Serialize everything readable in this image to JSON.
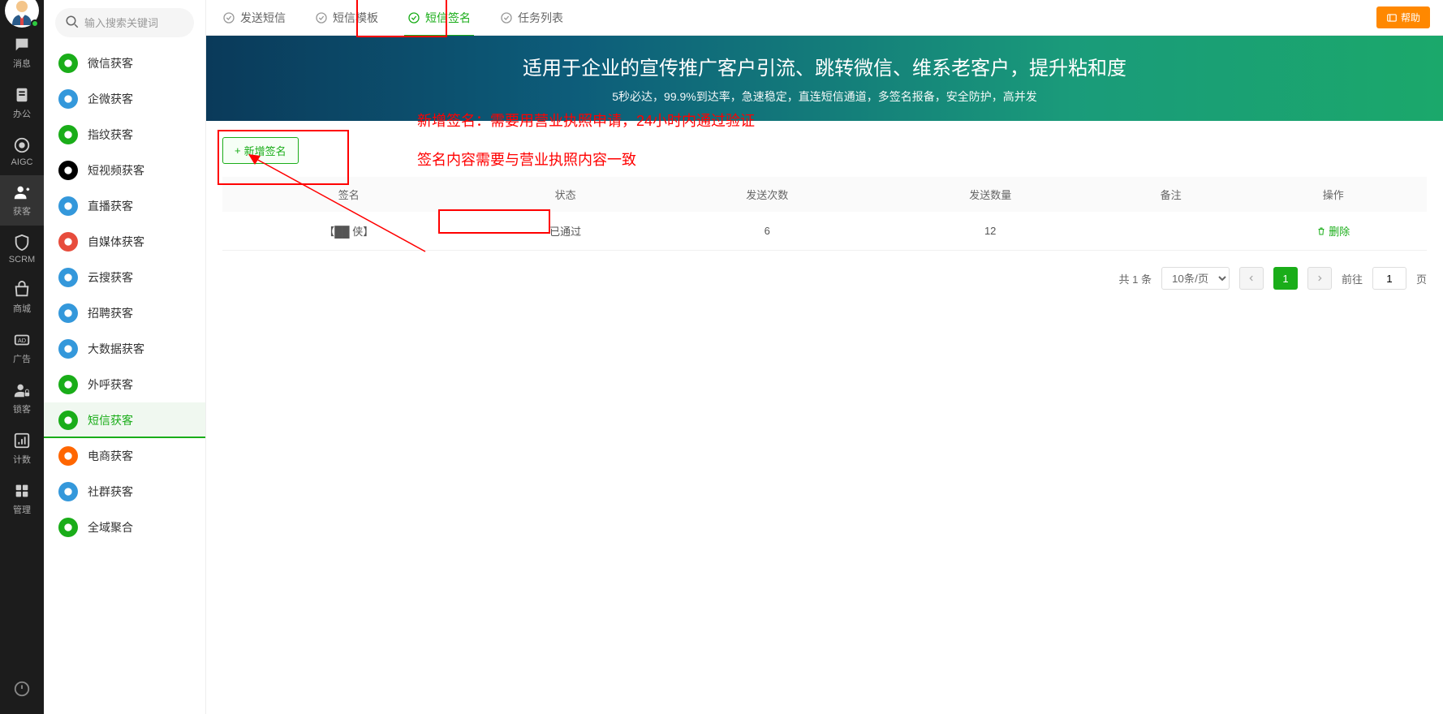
{
  "rail": {
    "items": [
      {
        "label": "消息",
        "icon": "message"
      },
      {
        "label": "办公",
        "icon": "badge"
      },
      {
        "label": "AIGC",
        "icon": "ai"
      },
      {
        "label": "获客",
        "icon": "user-plus",
        "active": true
      },
      {
        "label": "SCRM",
        "icon": "shield"
      },
      {
        "label": "商城",
        "icon": "shop"
      },
      {
        "label": "广告",
        "icon": "ad"
      },
      {
        "label": "锁客",
        "icon": "user-lock"
      },
      {
        "label": "计数",
        "icon": "chart"
      },
      {
        "label": "管理",
        "icon": "grid"
      }
    ]
  },
  "search": {
    "placeholder": "输入搜索关键词"
  },
  "sidebar": {
    "items": [
      {
        "label": "微信获客",
        "color": "#1aad19",
        "icon": "wechat"
      },
      {
        "label": "企微获客",
        "color": "#3498db",
        "icon": "chat"
      },
      {
        "label": "指纹获客",
        "color": "#1aad19",
        "icon": "fingerprint"
      },
      {
        "label": "短视频获客",
        "color": "#000",
        "icon": "video"
      },
      {
        "label": "直播获客",
        "color": "#3498db",
        "icon": "live"
      },
      {
        "label": "自媒体获客",
        "color": "#e74c3c",
        "icon": "media"
      },
      {
        "label": "云搜获客",
        "color": "#3498db",
        "icon": "cloud"
      },
      {
        "label": "招聘获客",
        "color": "#3498db",
        "icon": "recruit"
      },
      {
        "label": "大数据获客",
        "color": "#3498db",
        "icon": "data"
      },
      {
        "label": "外呼获客",
        "color": "#1aad19",
        "icon": "phone"
      },
      {
        "label": "短信获客",
        "color": "#1aad19",
        "icon": "sms",
        "active": true
      },
      {
        "label": "电商获客",
        "color": "#ff6600",
        "icon": "ecom"
      },
      {
        "label": "社群获客",
        "color": "#3498db",
        "icon": "group"
      },
      {
        "label": "全域聚合",
        "color": "#1aad19",
        "icon": "all"
      }
    ]
  },
  "tabs": [
    {
      "label": "发送短信"
    },
    {
      "label": "短信模板"
    },
    {
      "label": "短信签名",
      "active": true
    },
    {
      "label": "任务列表"
    }
  ],
  "help": "帮助",
  "banner": {
    "title": "适用于企业的宣传推广客户引流、跳转微信、维系老客户，提升粘和度",
    "subtitle": "5秒必达，99.9%到达率，急速稳定，直连短信通道，多签名报备，安全防护，高并发"
  },
  "addBtn": "新增签名",
  "table": {
    "headers": [
      "签名",
      "状态",
      "发送次数",
      "发送数量",
      "备注",
      "操作"
    ],
    "rows": [
      {
        "sign": "【██ 侠】",
        "status": "已通过",
        "sendCount": "6",
        "sendQty": "12",
        "remark": "",
        "action": "删除"
      }
    ]
  },
  "pager": {
    "total": "共 1 条",
    "perPage": "10条/页",
    "current": "1",
    "gotoLabel": "前往",
    "gotoValue": "1",
    "gotoSuffix": "页"
  },
  "annotations": {
    "line1": "新增签名：需要用营业执照申请，24小时内通过验证",
    "line2": "签名内容需要与营业执照内容一致"
  }
}
